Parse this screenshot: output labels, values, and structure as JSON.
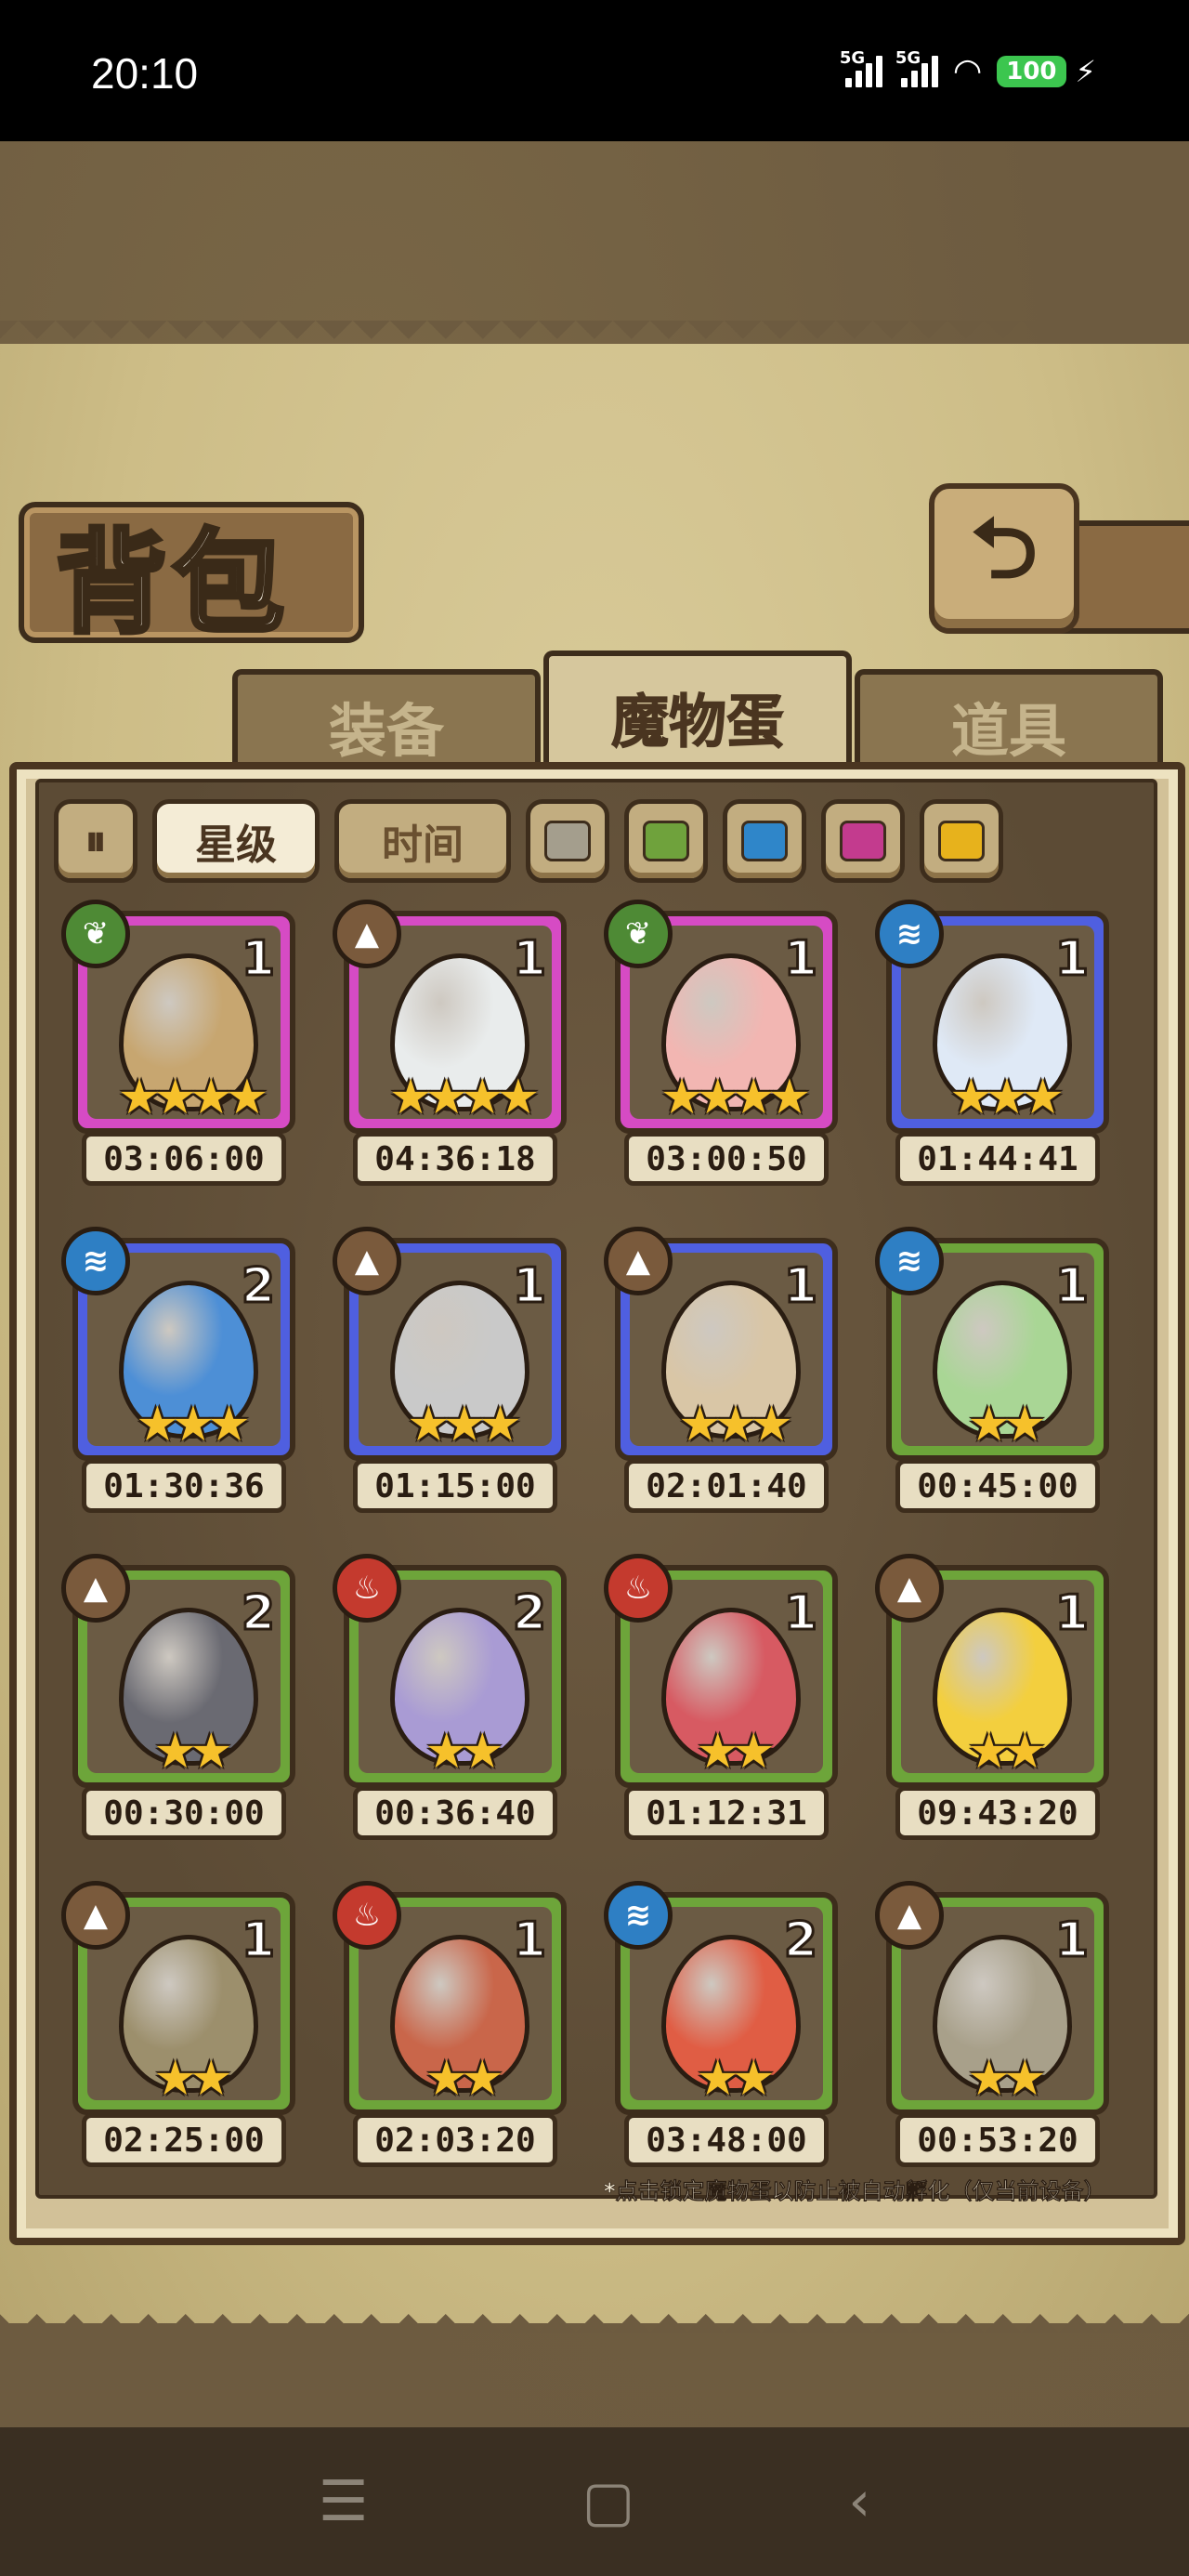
{
  "status_bar": {
    "time": "20:10",
    "sim1": "5G",
    "sim2": "5G",
    "battery": "100"
  },
  "header": {
    "title": "背包",
    "back_icon": "back-arrow-icon"
  },
  "tabs": [
    {
      "label": "装备",
      "active": false
    },
    {
      "label": "魔物蛋",
      "active": true
    },
    {
      "label": "道具",
      "active": false
    }
  ],
  "filters": {
    "sort_icon": "sort-toggle-icon",
    "star_label": "星级",
    "time_label": "时间",
    "colors": [
      "#a49e8d",
      "#6fa23c",
      "#2f86c9",
      "#c33b8e",
      "#e7b21c"
    ]
  },
  "eggs": [
    {
      "count": "1",
      "timer": "03:06:00",
      "stars": "★★★★",
      "element": "grass",
      "frame": "#d64bc4",
      "egg": "#c7a670"
    },
    {
      "count": "1",
      "timer": "04:36:18",
      "stars": "★★★★",
      "element": "earth",
      "frame": "#d64bc4",
      "egg": "#e9ecec"
    },
    {
      "count": "1",
      "timer": "03:00:50",
      "stars": "★★★★",
      "element": "grass",
      "frame": "#d64bc4",
      "egg": "#f2b6b2"
    },
    {
      "count": "1",
      "timer": "01:44:41",
      "stars": "★★★",
      "element": "water",
      "frame": "#4f5fe0",
      "egg": "#dfe9f6"
    },
    {
      "count": "2",
      "timer": "01:30:36",
      "stars": "★★★",
      "element": "water",
      "frame": "#4f5fe0",
      "egg": "#4d8fd6"
    },
    {
      "count": "1",
      "timer": "01:15:00",
      "stars": "★★★",
      "element": "earth",
      "frame": "#4f5fe0",
      "egg": "#c9c9c9"
    },
    {
      "count": "1",
      "timer": "02:01:40",
      "stars": "★★★",
      "element": "earth",
      "frame": "#4f5fe0",
      "egg": "#d9c6a6"
    },
    {
      "count": "1",
      "timer": "00:45:00",
      "stars": "★★",
      "element": "water",
      "frame": "#6da53a",
      "egg": "#a9d695"
    },
    {
      "count": "2",
      "timer": "00:30:00",
      "stars": "★★",
      "element": "earth",
      "frame": "#6da53a",
      "egg": "#6a6a72"
    },
    {
      "count": "2",
      "timer": "00:36:40",
      "stars": "★★",
      "element": "fire",
      "frame": "#6da53a",
      "egg": "#a99bd4"
    },
    {
      "count": "1",
      "timer": "01:12:31",
      "stars": "★★",
      "element": "fire",
      "frame": "#6da53a",
      "egg": "#d75a62"
    },
    {
      "count": "1",
      "timer": "09:43:20",
      "stars": "★★",
      "element": "earth",
      "frame": "#6da53a",
      "egg": "#f3cf3e"
    },
    {
      "count": "1",
      "timer": "02:25:00",
      "stars": "★★",
      "element": "earth",
      "frame": "#6da53a",
      "egg": "#9c8f6c"
    },
    {
      "count": "1",
      "timer": "02:03:20",
      "stars": "★★",
      "element": "fire",
      "frame": "#6da53a",
      "egg": "#c9664a"
    },
    {
      "count": "2",
      "timer": "03:48:00",
      "stars": "★★",
      "element": "water",
      "frame": "#6da53a",
      "egg": "#e05d44"
    },
    {
      "count": "1",
      "timer": "00:53:20",
      "stars": "★★",
      "element": "earth",
      "frame": "#6da53a",
      "egg": "#a8a08a"
    }
  ],
  "element_colors": {
    "grass": "#4e8a35",
    "earth": "#7a5a3c",
    "water": "#2e7fc4",
    "fire": "#c43a2e"
  },
  "element_glyphs": {
    "grass": "❦",
    "earth": "▲",
    "water": "≋",
    "fire": "♨"
  },
  "note": "*点击锁定魔物蛋以防止被自动孵化（仅当前设备）",
  "navbar": {
    "menu_icon": "☰",
    "home_icon": "▢",
    "back_icon": "‹"
  }
}
